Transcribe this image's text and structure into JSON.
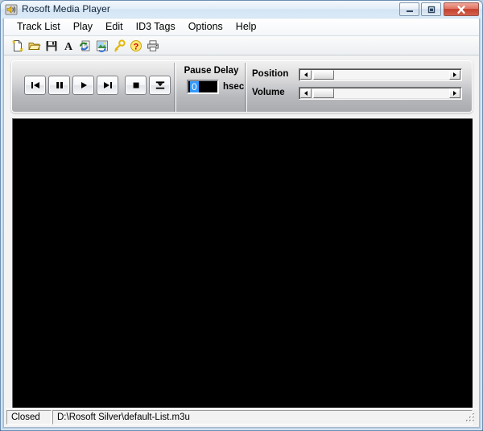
{
  "window": {
    "title": "Rosoft Media Player",
    "app_icon": "speaker-icon",
    "buttons": {
      "minimize": "Minimize",
      "maximize": "Maximize",
      "close": "Close"
    }
  },
  "menubar": {
    "items": [
      {
        "label": "Track List",
        "name": "menu-track-list"
      },
      {
        "label": "Play",
        "name": "menu-play"
      },
      {
        "label": "Edit",
        "name": "menu-edit"
      },
      {
        "label": "ID3 Tags",
        "name": "menu-id3-tags"
      },
      {
        "label": "Options",
        "name": "menu-options"
      },
      {
        "label": "Help",
        "name": "menu-help"
      }
    ]
  },
  "toolbar": {
    "items": [
      {
        "name": "new-file-icon",
        "title": "New"
      },
      {
        "name": "open-folder-icon",
        "title": "Open"
      },
      {
        "name": "save-disk-icon",
        "title": "Save"
      },
      {
        "name": "font-letter-icon",
        "title": "Font"
      },
      {
        "name": "refresh-page-icon",
        "title": "Refresh"
      },
      {
        "name": "image-capture-icon",
        "title": "Capture"
      },
      {
        "name": "key-icon",
        "title": "Key"
      },
      {
        "name": "help-question-icon",
        "title": "Help"
      },
      {
        "name": "printer-icon",
        "title": "Print"
      }
    ]
  },
  "transport": {
    "buttons": [
      {
        "name": "previous-track-button",
        "icon": "skip-back-icon"
      },
      {
        "name": "pause-button",
        "icon": "pause-icon"
      },
      {
        "name": "play-button",
        "icon": "play-icon"
      },
      {
        "name": "next-track-button",
        "icon": "skip-forward-icon"
      },
      {
        "name": "stop-button",
        "icon": "stop-icon"
      },
      {
        "name": "eject-button",
        "icon": "eject-icon"
      }
    ]
  },
  "pause_delay": {
    "label": "Pause Delay",
    "value": "0",
    "unit": "hsec"
  },
  "sliders": [
    {
      "name": "position-slider",
      "label": "Position",
      "value": 0
    },
    {
      "name": "volume-slider",
      "label": "Volume",
      "value": 0
    }
  ],
  "video": {
    "name": "video-display",
    "background_color": "#000000"
  },
  "statusbar": {
    "state": "Closed",
    "file_path": "D:\\Rosoft Silver\\default-List.m3u"
  },
  "colors": {
    "title_bar": "#e4eef8",
    "close_button": "#c33f2b",
    "selection": "#3399ff",
    "panel_top": "#f1f1f1",
    "panel_bottom": "#a9abaf"
  }
}
